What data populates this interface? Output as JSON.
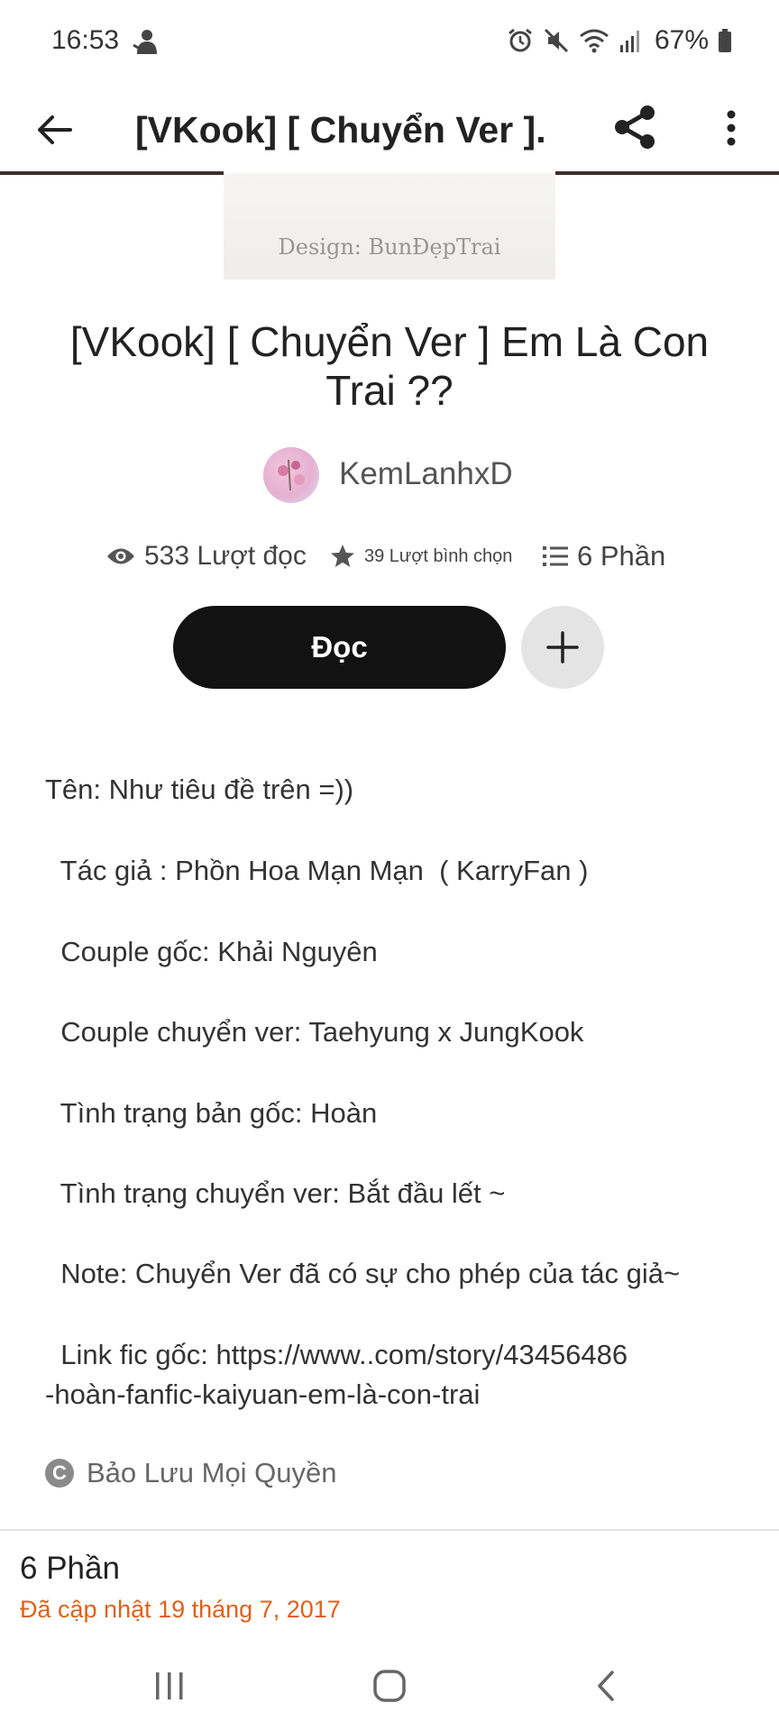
{
  "status_bar": {
    "time": "16:53",
    "battery": "67%"
  },
  "app_bar": {
    "title": "[VKook] [ Chuyển Ver ]..."
  },
  "cover": {
    "credit": "Design: BunĐẹpTrai"
  },
  "story": {
    "title": "[VKook] [ Chuyển Ver ] Em Là Con Trai ??",
    "author": "KemLanhxD",
    "stats": {
      "reads": "533 Lượt đọc",
      "votes": "39 Lượt bình chọn",
      "parts": "6 Phần"
    },
    "read_button": "Đọc"
  },
  "description": {
    "lines": [
      "Tên: Như tiêu đề trên =))",
      "  Tác giả : Phồn Hoa Mạn Mạn  ( KarryFan )",
      "  Couple gốc: Khải Nguyên",
      "  Couple chuyển ver: Taehyung x JungKook",
      "  Tình trạng bản gốc: Hoàn",
      "  Tình trạng chuyển ver: Bắt đầu lết ~",
      "  Note: Chuyển Ver đã có sự cho phép của tác giả~",
      "  Link fic gốc: https://www..com/story/43456486",
      "-hoàn-fanfic-kaiyuan-em-là-con-trai"
    ]
  },
  "copyright": "Bảo Lưu Mọi Quyền",
  "parts_section": {
    "count": "6 Phần",
    "updated": "Đã cập nhật 19 tháng 7, 2017"
  },
  "colors": {
    "accent_orange": "#e0611b",
    "read_button": "#121212",
    "add_button": "#e4e4e4"
  },
  "icons": {
    "back": "arrow-left-icon",
    "share": "share-icon",
    "more": "more-vertical-icon",
    "reads": "eye-icon",
    "votes": "star-icon",
    "parts": "list-icon",
    "add": "plus-icon",
    "copyright": "copyright-icon"
  }
}
